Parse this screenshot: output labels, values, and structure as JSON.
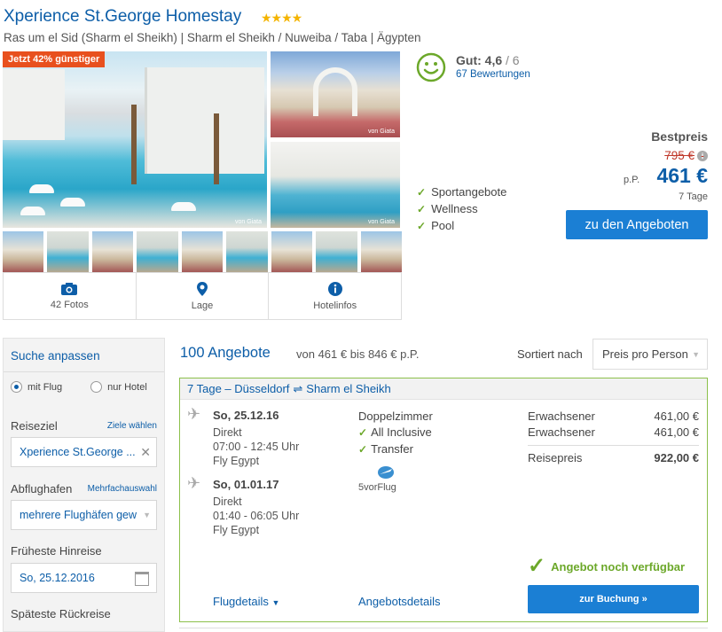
{
  "hotel": {
    "name": "Xperience St.George Homestay",
    "stars": "★★★★",
    "location": "Ras um el Sid (Sharm el Sheikh) | Sharm el Sheikh / Nuweiba / Taba | Ägypten"
  },
  "gallery": {
    "deal_badge": "Jetzt 42% günstiger",
    "credit": "von Giata",
    "tabs": [
      {
        "label": "42 Fotos",
        "icon": "camera-icon"
      },
      {
        "label": "Lage",
        "icon": "map-pin-icon"
      },
      {
        "label": "Hotelinfos",
        "icon": "info-icon"
      }
    ]
  },
  "rating": {
    "label": "Gut: 4,6",
    "max": "/ 6",
    "reviews": "67 Bewertungen"
  },
  "features": [
    "Sportangebote",
    "Wellness",
    "Pool"
  ],
  "price": {
    "best_label": "Bestpreis",
    "old": "795 €",
    "per_person": "p.P.",
    "new": "461 €",
    "duration": "7 Tage",
    "cta": "zu den Angeboten"
  },
  "search": {
    "title": "Suche anpassen",
    "radio_flight": "mit Flug",
    "radio_hotel": "nur Hotel",
    "destination_label": "Reiseziel",
    "destination_link": "Ziele wählen",
    "destination_value": "Xperience St.George ...",
    "airport_label": "Abflughafen",
    "airport_link": "Mehrfachauswahl",
    "airport_value": "mehrere Flughäfen gew",
    "earliest_label": "Früheste Hinreise",
    "earliest_value": "So, 25.12.2016",
    "latest_label": "Späteste Rückreise"
  },
  "results": {
    "count": "100 Angebote",
    "range": "von 461 € bis 846 € p.P.",
    "sort_label": "Sortiert nach",
    "sort_value": "Preis pro Person"
  },
  "offer": {
    "header_duration": "7 Tage – Düsseldorf",
    "header_arrow": "⇌",
    "header_destination": "Sharm el Sheikh",
    "outbound": {
      "date": "So, 25.12.16",
      "type": "Direkt",
      "time": "07:00 - 12:45 Uhr",
      "airline": "Fly Egypt"
    },
    "return": {
      "date": "So, 01.01.17",
      "type": "Direkt",
      "time": "01:40 - 06:05 Uhr",
      "airline": "Fly Egypt"
    },
    "room": "Doppelzimmer",
    "inclusions": [
      "All Inclusive",
      "Transfer"
    ],
    "operator": "5vorFlug",
    "pax": [
      {
        "label": "Erwachsener",
        "amount": "461,00 €"
      },
      {
        "label": "Erwachsener",
        "amount": "461,00 €"
      }
    ],
    "total_label": "Reisepreis",
    "total_amount": "922,00 €",
    "available": "Angebot noch verfügbar",
    "flight_details": "Flugdetails",
    "offer_details": "Angebotsdetails",
    "book": "zur Buchung »"
  }
}
